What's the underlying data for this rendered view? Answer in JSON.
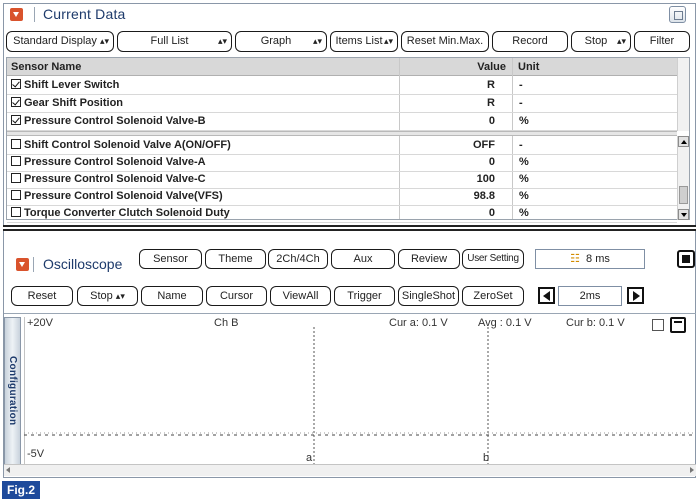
{
  "current_data": {
    "title": "Current Data",
    "toolbar": {
      "standard_display": "Standard Display",
      "full_list": "Full List",
      "graph": "Graph",
      "items_list": "Items List",
      "reset_minmax": "Reset Min.Max.",
      "record": "Record",
      "stop": "Stop",
      "filter": "Filter"
    },
    "columns": {
      "name": "Sensor Name",
      "value": "Value",
      "unit": "Unit"
    },
    "rows": [
      {
        "name": "Shift Lever Switch",
        "value": "R",
        "unit": "-",
        "checked": true
      },
      {
        "name": "Gear Shift Position",
        "value": "R",
        "unit": "-",
        "checked": true
      },
      {
        "name": "Pressure Control Solenoid Valve-B",
        "value": "0",
        "unit": "%",
        "checked": true
      },
      {
        "name": "Shift Control Solenoid Valve A(ON/OFF)",
        "value": "OFF",
        "unit": "-",
        "checked": false
      },
      {
        "name": "Pressure Control Solenoid Valve-A",
        "value": "0",
        "unit": "%",
        "checked": false
      },
      {
        "name": "Pressure Control Solenoid Valve-C",
        "value": "100",
        "unit": "%",
        "checked": false
      },
      {
        "name": "Pressure Control Solenoid Valve(VFS)",
        "value": "98.8",
        "unit": "%",
        "checked": false
      },
      {
        "name": "Torque Converter Clutch Solenoid Duty",
        "value": "0",
        "unit": "%",
        "checked": false
      }
    ]
  },
  "oscilloscope": {
    "title": "Oscilloscope",
    "buttons_row1": {
      "sensor": "Sensor",
      "theme": "Theme",
      "ch": "2Ch/4Ch",
      "aux": "Aux",
      "review": "Review",
      "user_setting": "User Setting"
    },
    "sample_time": "8 ms",
    "buttons_row2": {
      "reset": "Reset",
      "stop": "Stop",
      "name": "Name",
      "cursor": "Cursor",
      "viewall": "ViewAll",
      "trigger": "Trigger",
      "singleshot": "SingleShot",
      "zeroset": "ZeroSet"
    },
    "time_scale": "2ms",
    "config_tab": "Configuration",
    "scope": {
      "y_max": "+20V",
      "y_min": "-5V",
      "channel": "Ch B",
      "cursor_a_readout": "Cur a: 0.1 V",
      "avg_readout": "Avg : 0.1 V",
      "cursor_b_readout": "Cur b: 0.1 V",
      "cursor_a_label": "a",
      "cursor_b_label": "b"
    }
  },
  "figure_label": "Fig.2"
}
